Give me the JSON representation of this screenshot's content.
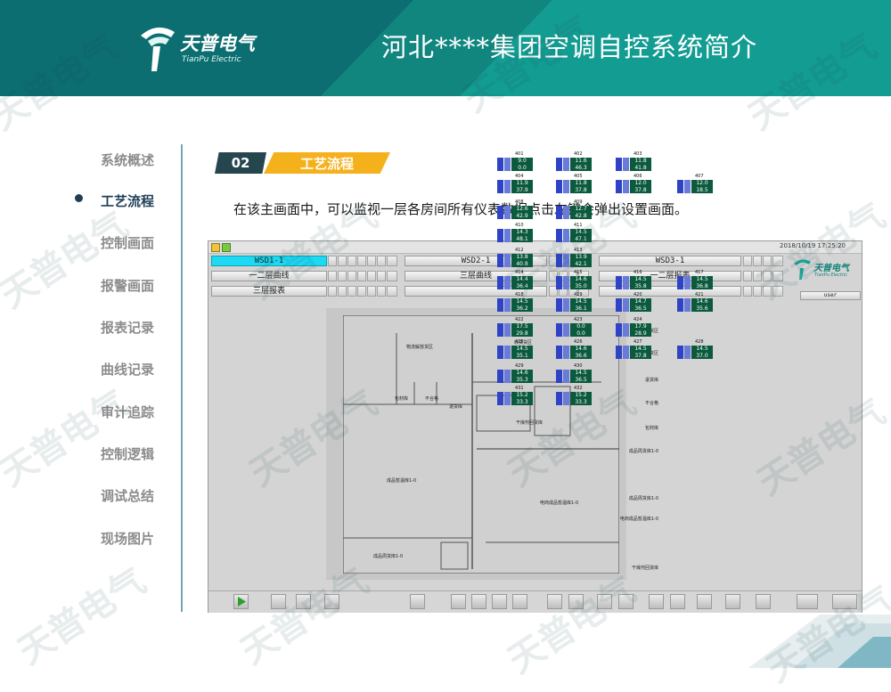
{
  "header": {
    "title": "河北****集团空调自控系统简介",
    "logo_name": "天普电气",
    "logo_sub": "TianPu Electric"
  },
  "colors": {
    "header_teal": "#139c92",
    "header_dark": "#0d6e71",
    "accent_yellow": "#f5b11c",
    "section_dark": "#25464f",
    "nav_active": "#1f3f57",
    "nav_inactive": "#8c8c8c",
    "selected_tab": "#1ed9f2",
    "meter_bg": "#0b5a3d"
  },
  "sidebar": {
    "items": [
      {
        "label": "系统概述",
        "active": false
      },
      {
        "label": "工艺流程",
        "active": true
      },
      {
        "label": "控制画面",
        "active": false
      },
      {
        "label": "报警画面",
        "active": false
      },
      {
        "label": "报表记录",
        "active": false
      },
      {
        "label": "曲线记录",
        "active": false
      },
      {
        "label": "审计追踪",
        "active": false
      },
      {
        "label": "控制逻辑",
        "active": false
      },
      {
        "label": "调试总结",
        "active": false
      },
      {
        "label": "现场图片",
        "active": false
      }
    ]
  },
  "section": {
    "number": "02",
    "title": "工艺流程"
  },
  "intro": "在该主画面中，可以监视一层各房间所有仪表数据点击左键会弹出设置画面。",
  "scada": {
    "timestamp": "2018/10/19 17:25:20",
    "logo_name": "天普电气",
    "logo_sub": "TianPu Electric",
    "user_label": "user",
    "nav_buttons": [
      "WSD1-1",
      "WSD2-1",
      "WSD3-1",
      "一二层曲线",
      "三层曲线",
      "一二层报表",
      "三层报表"
    ],
    "room_labels": [
      "物流解放货区",
      "收货货区",
      "包材库",
      "不合格",
      "退货库",
      "干燥剂回货库",
      "成品暂温库1-0",
      "电商成品暂温库1-0",
      "成品周货库1-0"
    ],
    "row_labels": [
      "收货货区",
      "物流解放货区",
      "退货库",
      "不合格",
      "包材库",
      "成品周货库1-0",
      "成品周货库1-0",
      "电商成品暂温库1-0",
      "干燥剂回货库"
    ],
    "meters": [
      {
        "id": "401",
        "t": "9.0",
        "h": "0.0"
      },
      {
        "id": "402",
        "t": "11.6",
        "h": "46.3"
      },
      {
        "id": "403",
        "t": "11.8",
        "h": "41.8"
      },
      {
        "id": "404",
        "t": "11.9",
        "h": "37.9"
      },
      {
        "id": "405",
        "t": "11.8",
        "h": "37.8"
      },
      {
        "id": "406",
        "t": "12.0",
        "h": "37.8"
      },
      {
        "id": "407",
        "t": "12.0",
        "h": "18.5"
      },
      {
        "id": "408",
        "t": "12.6",
        "h": "42.9"
      },
      {
        "id": "409",
        "t": "12.7",
        "h": "42.8"
      },
      {
        "id": "410",
        "t": "14.3",
        "h": "48.1"
      },
      {
        "id": "411",
        "t": "14.5",
        "h": "47.1"
      },
      {
        "id": "412",
        "t": "13.8",
        "h": "40.8"
      },
      {
        "id": "413",
        "t": "13.9",
        "h": "42.1"
      },
      {
        "id": "414",
        "t": "14.4",
        "h": "36.4"
      },
      {
        "id": "415",
        "t": "14.6",
        "h": "35.0"
      },
      {
        "id": "416",
        "t": "14.5",
        "h": "35.8"
      },
      {
        "id": "417",
        "t": "14.5",
        "h": "36.8"
      },
      {
        "id": "418",
        "t": "14.5",
        "h": "36.2"
      },
      {
        "id": "419",
        "t": "14.5",
        "h": "36.1"
      },
      {
        "id": "420",
        "t": "14.7",
        "h": "36.5"
      },
      {
        "id": "421",
        "t": "14.6",
        "h": "35.6"
      },
      {
        "id": "422",
        "t": "17.5",
        "h": "29.8"
      },
      {
        "id": "423",
        "t": "0.0",
        "h": "0.0"
      },
      {
        "id": "424",
        "t": "17.9",
        "h": "28.9"
      },
      {
        "id": "425",
        "t": "14.5",
        "h": "35.1"
      },
      {
        "id": "426",
        "t": "14.6",
        "h": "36.6"
      },
      {
        "id": "427",
        "t": "14.5",
        "h": "37.8"
      },
      {
        "id": "428",
        "t": "14.5",
        "h": "37.0"
      },
      {
        "id": "429",
        "t": "14.6",
        "h": "35.3"
      },
      {
        "id": "430",
        "t": "14.5",
        "h": "36.5"
      },
      {
        "id": "431",
        "t": "15.2",
        "h": "33.3"
      },
      {
        "id": "432",
        "t": "15.2",
        "h": "33.3"
      }
    ]
  },
  "watermark": "天普电气"
}
